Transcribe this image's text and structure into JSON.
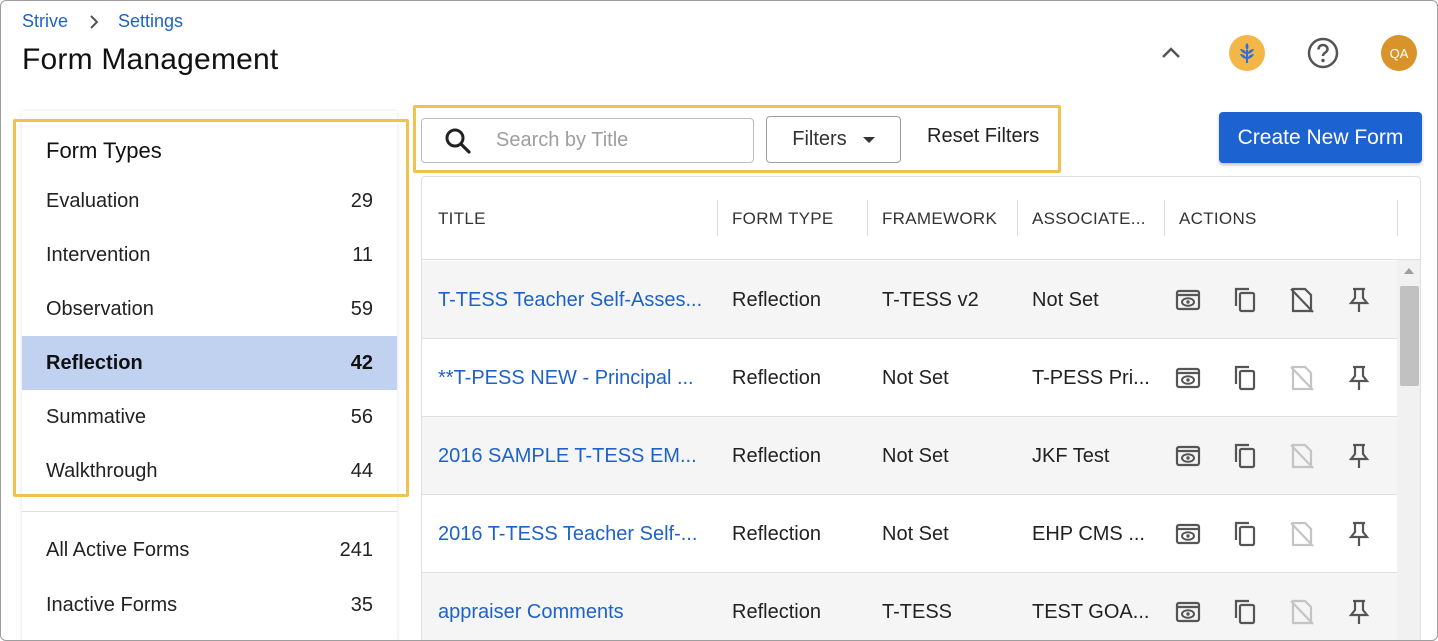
{
  "breadcrumb": {
    "root": "Strive",
    "current": "Settings"
  },
  "page_title": "Form Management",
  "header": {
    "avatar_initials": "QA",
    "brand_color": "#f3b648",
    "avatar_color": "#d8932a"
  },
  "sidebar": {
    "title": "Form Types",
    "types": [
      {
        "label": "Evaluation",
        "count": "29"
      },
      {
        "label": "Intervention",
        "count": "11"
      },
      {
        "label": "Observation",
        "count": "59"
      },
      {
        "label": "Reflection",
        "count": "42",
        "selected": true
      },
      {
        "label": "Summative",
        "count": "56"
      },
      {
        "label": "Walkthrough",
        "count": "44"
      }
    ],
    "totals": [
      {
        "label": "All Active Forms",
        "count": "241"
      },
      {
        "label": "Inactive Forms",
        "count": "35"
      }
    ]
  },
  "toolbar": {
    "search_placeholder": "Search by Title",
    "filters_label": "Filters",
    "reset_label": "Reset Filters",
    "create_label": "Create New Form",
    "accent_color": "#1d62d1"
  },
  "table": {
    "columns": [
      "TITLE",
      "FORM TYPE",
      "FRAMEWORK",
      "ASSOCIATE...",
      "ACTIONS"
    ],
    "rows": [
      {
        "title": "T-TESS Teacher Self-Asses...",
        "form_type": "Reflection",
        "framework": "T-TESS v2",
        "associated": "Not Set",
        "deactivate_enabled": true
      },
      {
        "title": "**T-PESS NEW - Principal ...",
        "form_type": "Reflection",
        "framework": "Not Set",
        "associated": "T-PESS Pri...",
        "deactivate_enabled": false
      },
      {
        "title": "2016 SAMPLE T-TESS EM...",
        "form_type": "Reflection",
        "framework": "Not Set",
        "associated": "JKF Test",
        "deactivate_enabled": false
      },
      {
        "title": "2016 T-TESS Teacher Self-...",
        "form_type": "Reflection",
        "framework": "Not Set",
        "associated": "EHP CMS ...",
        "deactivate_enabled": false
      },
      {
        "title": "appraiser Comments",
        "form_type": "Reflection",
        "framework": "T-TESS",
        "associated": "TEST GOA...",
        "deactivate_enabled": false
      }
    ]
  }
}
